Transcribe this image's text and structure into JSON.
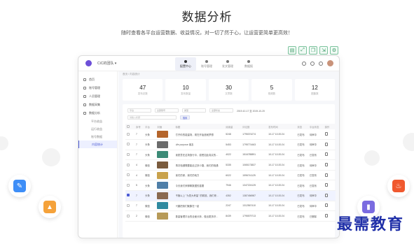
{
  "hero": {
    "title": "数据分析",
    "subtitle": "随时查看各平台运营数据、收益情况，对一切了然于心，让运营更简单更高效！"
  },
  "toolbar_icons": [
    "doc-icon",
    "expand-icon",
    "copy-icon",
    "export-icon",
    "settings-icon"
  ],
  "float_icons": [
    {
      "name": "edit-doc-icon",
      "color": "#3e8ef7"
    },
    {
      "name": "image-icon",
      "color": "#f5a23a"
    },
    {
      "name": "fire-icon",
      "color": "#f0592f"
    },
    {
      "name": "chart-icon",
      "color": "#7a6be0"
    }
  ],
  "app": {
    "team_name": "CiC的团队",
    "nav_tabs": [
      {
        "label": "配置中心",
        "active": true
      },
      {
        "label": "账号管理",
        "active": false
      },
      {
        "label": "发文管理",
        "active": false
      },
      {
        "label": "数据报",
        "active": false
      }
    ],
    "sidebar": {
      "items": [
        {
          "label": "首页"
        },
        {
          "label": "账号管理"
        },
        {
          "label": "人员管理"
        },
        {
          "label": "数据采集"
        },
        {
          "label": "数据分析"
        }
      ],
      "subitems": [
        {
          "label": "平台收益",
          "active": false
        },
        {
          "label": "运行收益",
          "active": false
        },
        {
          "label": "账号数据",
          "active": false
        },
        {
          "label": "内容统计",
          "active": true
        }
      ]
    },
    "breadcrumb": "首页  /  内容统计",
    "stats": [
      {
        "value": "47",
        "label": "发布总数"
      },
      {
        "value": "10",
        "label": "发布数量"
      },
      {
        "value": "30",
        "label": "文章数"
      },
      {
        "value": "5",
        "label": "视频数"
      },
      {
        "value": "12",
        "label": "图集数"
      }
    ],
    "filters": {
      "platform": "平台",
      "account": "全部账号",
      "type": "类型",
      "status": "全部状态",
      "date_text": "2019-10-17  至  2019-10-20",
      "search_placeholder": "请输入标题",
      "search_button": "搜索"
    },
    "table": {
      "columns": [
        "",
        "序号",
        "平台",
        "封面",
        "标题",
        "阅读量",
        "评论数",
        "发布时间",
        "状态",
        "平台状态",
        "操作"
      ],
      "rows": [
        {
          "idx": "7",
          "platform": "头条",
          "title": "打开你的能量场，现在开始造就梦想",
          "reads": "5248",
          "comments": "1795374274",
          "time": "10-17 10:20:24",
          "status": "已发布",
          "pstatus": "待审中",
          "thumb": "#b5652b",
          "checked": false
        },
        {
          "idx": "7",
          "platform": "头条",
          "title": "We purpose 朋友",
          "reads": "5453",
          "comments": "1795774463",
          "time": "10-17 10:20:24",
          "status": "已发布",
          "pstatus": "待审中",
          "thumb": "#6b6b6b",
          "checked": false
        },
        {
          "idx": "7",
          "platform": "头条",
          "title": "我愿意在这场旅行中，感受如此真实的一切与人生",
          "reads": "4022",
          "comments": "1516785891",
          "time": "10-17 10:20:24",
          "status": "已发布",
          "pstatus": "已发布",
          "thumb": "#3b8a76",
          "checked": false
        },
        {
          "idx": "4",
          "platform": "微信",
          "title": "再次相遇需要能走过多少路，我们的相遇",
          "reads": "5335",
          "comments": "1065173837",
          "time": "10-17 10:20:24",
          "status": "已发布",
          "pstatus": "待审中",
          "thumb": "#7a5b3d",
          "checked": false
        },
        {
          "idx": "4",
          "platform": "微信",
          "title": "我们的家，我们的地方",
          "reads": "6022",
          "comments": "1596741125",
          "time": "10-17 10:20:24",
          "status": "已发布",
          "pstatus": "已发布",
          "thumb": "#c9a24b",
          "checked": false
        },
        {
          "idx": "5",
          "platform": "头条",
          "title": "今天我们来聊聊数据的重要",
          "reads": "7946",
          "comments": "1347224125",
          "time": "10-17 10:20:24",
          "status": "已发布",
          "pstatus": "已发布",
          "thumb": "#4f7fa8",
          "checked": false
        },
        {
          "idx": "7",
          "platform": "头条",
          "title": "不管以上 \"为您大考量\" 的精准，我们来到了 \"采集系统\" 的界面",
          "reads": "4352",
          "comments": "1387456987",
          "time": "10-17 10:20:24",
          "status": "已发布",
          "pstatus": "待审中",
          "thumb": "#8a6a4f",
          "checked": true
        },
        {
          "idx": "7",
          "platform": "微信",
          "title": "兴趣把我们聚集在一起",
          "reads": "2247",
          "comments": "1312567410",
          "time": "10-17 10:20:24",
          "status": "已发布",
          "pstatus": "待审中",
          "thumb": "#2f8aa0",
          "checked": false
        },
        {
          "idx": "2",
          "platform": "微信",
          "title": "数量管理平台的全面分析，做出更多好的运营，我们在做数据的道路上",
          "reads": "8439",
          "comments": "1795579713",
          "time": "10-17 10:20:24",
          "status": "已发布",
          "pstatus": "已删除",
          "thumb": "#b79a58",
          "checked": false
        }
      ]
    }
  },
  "watermark": "最需教育"
}
